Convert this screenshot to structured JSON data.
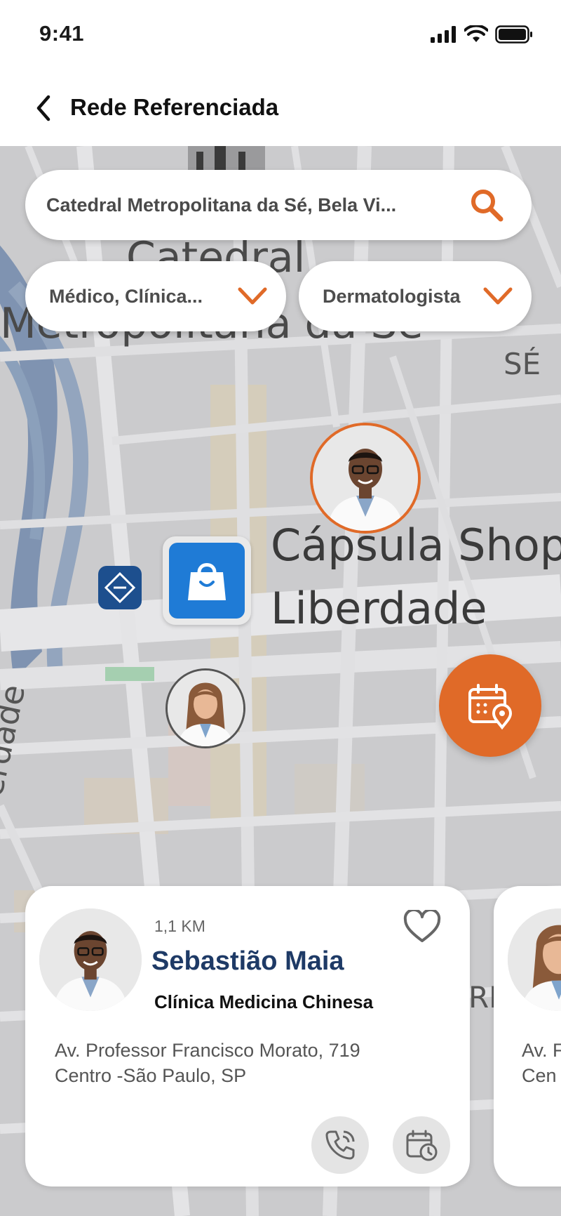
{
  "status_bar": {
    "time": "9:41"
  },
  "header": {
    "title": "Rede Referenciada"
  },
  "search": {
    "value": "Catedral Metropolitana da Sé, Bela Vi..."
  },
  "filters": [
    {
      "label": "Médico, Clínica..."
    },
    {
      "label": "Dermatologista"
    }
  ],
  "map_labels": {
    "catedral": "Catedral",
    "metropolitana": "Metropolitana da Sé",
    "se": "SÉ",
    "capsula": "Cápsula Shop",
    "liberdade": "Liberdade",
    "liberdade_vertical": "erdade",
    "rd": "RD"
  },
  "cards": [
    {
      "distance": "1,1 KM",
      "name": "Sebastião Maia",
      "clinic": "Clínica Medicina Chinesa",
      "address_line1": "Av. Professor Francisco Morato, 719",
      "address_line2": "Centro -São Paulo, SP"
    },
    {
      "address_line1": "Av. F",
      "address_line2": "Cen"
    }
  ],
  "colors": {
    "accent": "#e06a28",
    "name": "#1e3a66",
    "map": "#c9c9cb"
  }
}
